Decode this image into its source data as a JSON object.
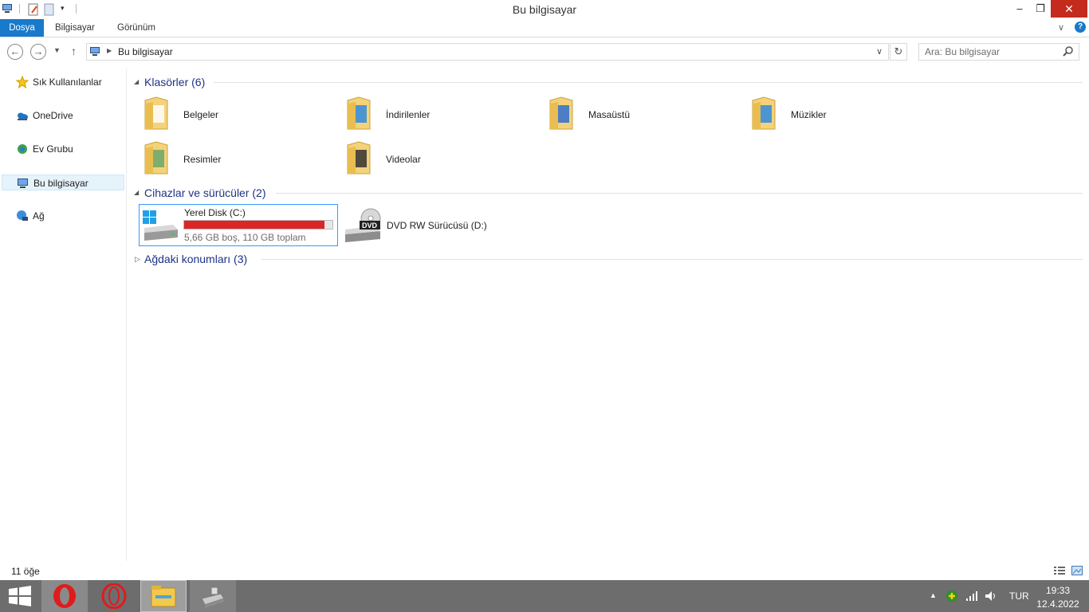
{
  "window": {
    "title": "Bu bilgisayar"
  },
  "ribbon": {
    "tabs": [
      "Dosya",
      "Bilgisayar",
      "Görünüm"
    ]
  },
  "address": {
    "path": "Bu bilgisayar",
    "search_placeholder": "Ara: Bu bilgisayar"
  },
  "nav": {
    "items": [
      {
        "label": "Sık Kullanılanlar",
        "icon": "star-icon"
      },
      {
        "label": "OneDrive",
        "icon": "onedrive-icon"
      },
      {
        "label": "Ev Grubu",
        "icon": "homegroup-icon"
      },
      {
        "label": "Bu bilgisayar",
        "icon": "computer-icon",
        "selected": true
      },
      {
        "label": "Ağ",
        "icon": "network-icon"
      }
    ]
  },
  "groups": {
    "folders": {
      "title": "Klasörler (6)",
      "items": [
        "Belgeler",
        "İndirilenler",
        "Masaüstü",
        "Müzikler",
        "Resimler",
        "Videolar"
      ]
    },
    "devices": {
      "title": "Cihazlar ve sürücüler (2)",
      "drive_c": {
        "name": "Yerel Disk (C:)",
        "info": "5,66 GB boş, 110 GB toplam",
        "used_fraction": 0.9485
      },
      "drive_d": {
        "name": "DVD RW Sürücüsü (D:)",
        "badge": "DVD"
      }
    },
    "network": {
      "title": "Ağdaki konumları (3)"
    }
  },
  "status": {
    "count": "11 öğe"
  },
  "taskbar": {
    "lang": "TUR",
    "time": "19:33",
    "date": "12.4.2022"
  },
  "colors": {
    "accent": "#1979ca",
    "usage_bar": "#da2626",
    "taskbar": "#6d6d6d",
    "close": "#c42b1c"
  }
}
